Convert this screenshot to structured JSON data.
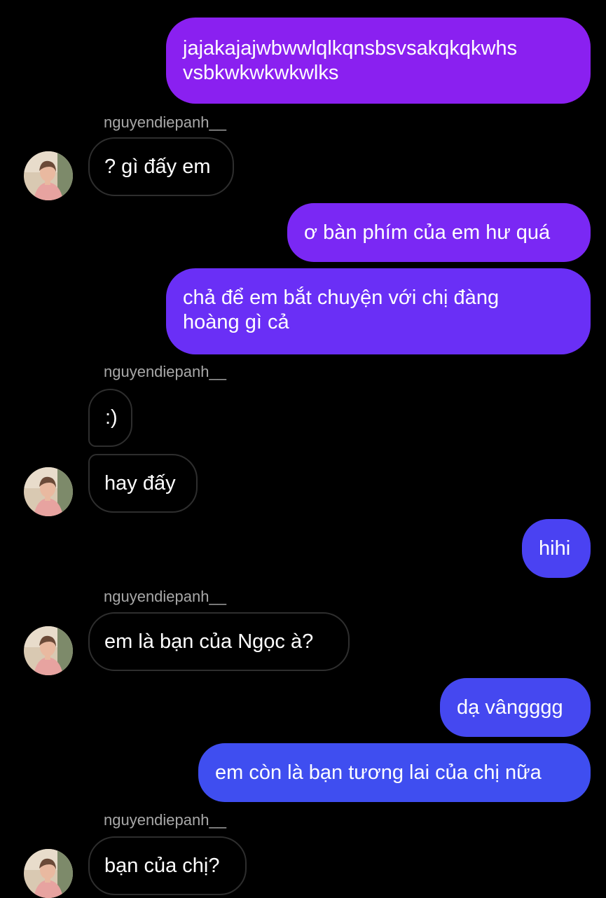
{
  "colors": {
    "background": "#000000",
    "bubble_purple": "#8a20f0",
    "bubble_violet": "#6a2ff6",
    "bubble_blue": "#3f4ef0",
    "incoming_border": "#2e2e2e",
    "sender_name": "#a8a8a8"
  },
  "contact": {
    "username": "nguyendiepanh__",
    "avatar_icon": "profile-photo"
  },
  "messages": [
    {
      "id": "m1",
      "direction": "outgoing",
      "lines": [
        "jajakajajwbwwlqlkqnsbsvsakqkqkwhs",
        "vsbkwkwkwkwlks"
      ]
    },
    {
      "id": "m2",
      "direction": "incoming",
      "sender": "nguyendiepanh__",
      "text": "? gì đấy em"
    },
    {
      "id": "m3",
      "direction": "outgoing",
      "text": "ơ bàn phím của em hư quá"
    },
    {
      "id": "m4",
      "direction": "outgoing",
      "lines": [
        "chả để em bắt chuyện với chị đàng",
        "hoàng gì cả"
      ]
    },
    {
      "id": "m5",
      "direction": "incoming",
      "sender": "nguyendiepanh__",
      "text": ":)"
    },
    {
      "id": "m6",
      "direction": "incoming",
      "text": "hay đấy"
    },
    {
      "id": "m7",
      "direction": "outgoing",
      "text": "hihi"
    },
    {
      "id": "m8",
      "direction": "incoming",
      "sender": "nguyendiepanh__",
      "text": "em là bạn của Ngọc à?"
    },
    {
      "id": "m9",
      "direction": "outgoing",
      "text": "dạ vângggg"
    },
    {
      "id": "m10",
      "direction": "outgoing",
      "text": "em còn là bạn tương lai của chị nữa"
    },
    {
      "id": "m11",
      "direction": "incoming",
      "sender": "nguyendiepanh__",
      "text": "bạn của chị?"
    }
  ]
}
